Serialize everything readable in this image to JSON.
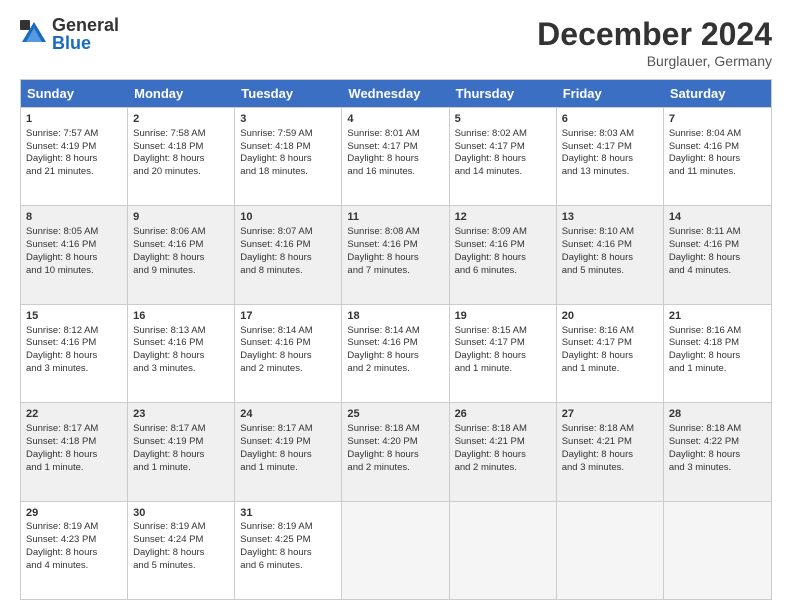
{
  "logo": {
    "general": "General",
    "blue": "Blue"
  },
  "title": "December 2024",
  "location": "Burglauer, Germany",
  "days_of_week": [
    "Sunday",
    "Monday",
    "Tuesday",
    "Wednesday",
    "Thursday",
    "Friday",
    "Saturday"
  ],
  "weeks": [
    [
      {
        "day": "1",
        "lines": [
          "Sunrise: 7:57 AM",
          "Sunset: 4:19 PM",
          "Daylight: 8 hours",
          "and 21 minutes."
        ],
        "shaded": false
      },
      {
        "day": "2",
        "lines": [
          "Sunrise: 7:58 AM",
          "Sunset: 4:18 PM",
          "Daylight: 8 hours",
          "and 20 minutes."
        ],
        "shaded": false
      },
      {
        "day": "3",
        "lines": [
          "Sunrise: 7:59 AM",
          "Sunset: 4:18 PM",
          "Daylight: 8 hours",
          "and 18 minutes."
        ],
        "shaded": false
      },
      {
        "day": "4",
        "lines": [
          "Sunrise: 8:01 AM",
          "Sunset: 4:17 PM",
          "Daylight: 8 hours",
          "and 16 minutes."
        ],
        "shaded": false
      },
      {
        "day": "5",
        "lines": [
          "Sunrise: 8:02 AM",
          "Sunset: 4:17 PM",
          "Daylight: 8 hours",
          "and 14 minutes."
        ],
        "shaded": false
      },
      {
        "day": "6",
        "lines": [
          "Sunrise: 8:03 AM",
          "Sunset: 4:17 PM",
          "Daylight: 8 hours",
          "and 13 minutes."
        ],
        "shaded": false
      },
      {
        "day": "7",
        "lines": [
          "Sunrise: 8:04 AM",
          "Sunset: 4:16 PM",
          "Daylight: 8 hours",
          "and 11 minutes."
        ],
        "shaded": false
      }
    ],
    [
      {
        "day": "8",
        "lines": [
          "Sunrise: 8:05 AM",
          "Sunset: 4:16 PM",
          "Daylight: 8 hours",
          "and 10 minutes."
        ],
        "shaded": true
      },
      {
        "day": "9",
        "lines": [
          "Sunrise: 8:06 AM",
          "Sunset: 4:16 PM",
          "Daylight: 8 hours",
          "and 9 minutes."
        ],
        "shaded": true
      },
      {
        "day": "10",
        "lines": [
          "Sunrise: 8:07 AM",
          "Sunset: 4:16 PM",
          "Daylight: 8 hours",
          "and 8 minutes."
        ],
        "shaded": true
      },
      {
        "day": "11",
        "lines": [
          "Sunrise: 8:08 AM",
          "Sunset: 4:16 PM",
          "Daylight: 8 hours",
          "and 7 minutes."
        ],
        "shaded": true
      },
      {
        "day": "12",
        "lines": [
          "Sunrise: 8:09 AM",
          "Sunset: 4:16 PM",
          "Daylight: 8 hours",
          "and 6 minutes."
        ],
        "shaded": true
      },
      {
        "day": "13",
        "lines": [
          "Sunrise: 8:10 AM",
          "Sunset: 4:16 PM",
          "Daylight: 8 hours",
          "and 5 minutes."
        ],
        "shaded": true
      },
      {
        "day": "14",
        "lines": [
          "Sunrise: 8:11 AM",
          "Sunset: 4:16 PM",
          "Daylight: 8 hours",
          "and 4 minutes."
        ],
        "shaded": true
      }
    ],
    [
      {
        "day": "15",
        "lines": [
          "Sunrise: 8:12 AM",
          "Sunset: 4:16 PM",
          "Daylight: 8 hours",
          "and 3 minutes."
        ],
        "shaded": false
      },
      {
        "day": "16",
        "lines": [
          "Sunrise: 8:13 AM",
          "Sunset: 4:16 PM",
          "Daylight: 8 hours",
          "and 3 minutes."
        ],
        "shaded": false
      },
      {
        "day": "17",
        "lines": [
          "Sunrise: 8:14 AM",
          "Sunset: 4:16 PM",
          "Daylight: 8 hours",
          "and 2 minutes."
        ],
        "shaded": false
      },
      {
        "day": "18",
        "lines": [
          "Sunrise: 8:14 AM",
          "Sunset: 4:16 PM",
          "Daylight: 8 hours",
          "and 2 minutes."
        ],
        "shaded": false
      },
      {
        "day": "19",
        "lines": [
          "Sunrise: 8:15 AM",
          "Sunset: 4:17 PM",
          "Daylight: 8 hours",
          "and 1 minute."
        ],
        "shaded": false
      },
      {
        "day": "20",
        "lines": [
          "Sunrise: 8:16 AM",
          "Sunset: 4:17 PM",
          "Daylight: 8 hours",
          "and 1 minute."
        ],
        "shaded": false
      },
      {
        "day": "21",
        "lines": [
          "Sunrise: 8:16 AM",
          "Sunset: 4:18 PM",
          "Daylight: 8 hours",
          "and 1 minute."
        ],
        "shaded": false
      }
    ],
    [
      {
        "day": "22",
        "lines": [
          "Sunrise: 8:17 AM",
          "Sunset: 4:18 PM",
          "Daylight: 8 hours",
          "and 1 minute."
        ],
        "shaded": true
      },
      {
        "day": "23",
        "lines": [
          "Sunrise: 8:17 AM",
          "Sunset: 4:19 PM",
          "Daylight: 8 hours",
          "and 1 minute."
        ],
        "shaded": true
      },
      {
        "day": "24",
        "lines": [
          "Sunrise: 8:17 AM",
          "Sunset: 4:19 PM",
          "Daylight: 8 hours",
          "and 1 minute."
        ],
        "shaded": true
      },
      {
        "day": "25",
        "lines": [
          "Sunrise: 8:18 AM",
          "Sunset: 4:20 PM",
          "Daylight: 8 hours",
          "and 2 minutes."
        ],
        "shaded": true
      },
      {
        "day": "26",
        "lines": [
          "Sunrise: 8:18 AM",
          "Sunset: 4:21 PM",
          "Daylight: 8 hours",
          "and 2 minutes."
        ],
        "shaded": true
      },
      {
        "day": "27",
        "lines": [
          "Sunrise: 8:18 AM",
          "Sunset: 4:21 PM",
          "Daylight: 8 hours",
          "and 3 minutes."
        ],
        "shaded": true
      },
      {
        "day": "28",
        "lines": [
          "Sunrise: 8:18 AM",
          "Sunset: 4:22 PM",
          "Daylight: 8 hours",
          "and 3 minutes."
        ],
        "shaded": true
      }
    ],
    [
      {
        "day": "29",
        "lines": [
          "Sunrise: 8:19 AM",
          "Sunset: 4:23 PM",
          "Daylight: 8 hours",
          "and 4 minutes."
        ],
        "shaded": false
      },
      {
        "day": "30",
        "lines": [
          "Sunrise: 8:19 AM",
          "Sunset: 4:24 PM",
          "Daylight: 8 hours",
          "and 5 minutes."
        ],
        "shaded": false
      },
      {
        "day": "31",
        "lines": [
          "Sunrise: 8:19 AM",
          "Sunset: 4:25 PM",
          "Daylight: 8 hours",
          "and 6 minutes."
        ],
        "shaded": false
      },
      {
        "day": "",
        "lines": [],
        "empty": true,
        "shaded": false
      },
      {
        "day": "",
        "lines": [],
        "empty": true,
        "shaded": false
      },
      {
        "day": "",
        "lines": [],
        "empty": true,
        "shaded": false
      },
      {
        "day": "",
        "lines": [],
        "empty": true,
        "shaded": false
      }
    ]
  ]
}
